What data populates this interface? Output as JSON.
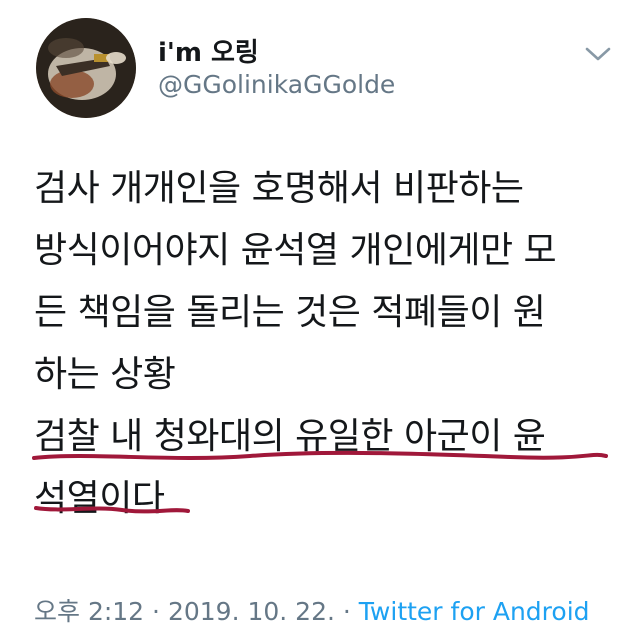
{
  "user": {
    "display_name": "i'm 오링",
    "handle": "@GGolinikaGGolde"
  },
  "tweet": {
    "lines": [
      "검사 개개인을 호명해서 비판하는",
      "방식이어야지 윤석열 개인에게만 모",
      "든 책임을 돌리는 것은 적폐들이 원",
      "하는 상황",
      "검찰 내 청와대의 유일한 아군이 윤",
      "석열이다"
    ]
  },
  "meta": {
    "time": "오후 2:12",
    "date": "2019. 10. 22.",
    "separator": "·",
    "source": "Twitter for Android"
  },
  "colors": {
    "text": "#14171a",
    "muted": "#657786",
    "link": "#1da1f2",
    "annotation": "#a0183a"
  },
  "icons": {
    "menu": "chevron-down-icon"
  }
}
